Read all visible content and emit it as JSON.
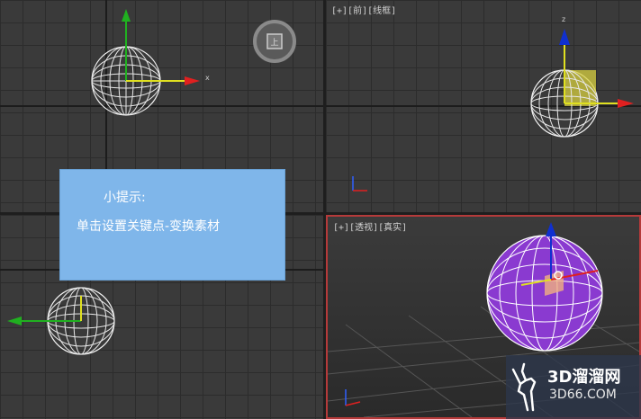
{
  "viewports": {
    "top_right": {
      "label": "[+][前][线框]"
    },
    "bottom_right": {
      "label": "[+][透视][真实]"
    }
  },
  "tip": {
    "title": "小提示:",
    "body": "单击设置关键点-变换素材"
  },
  "watermark": {
    "main": "3D溜溜网",
    "sub": "3D66.COM"
  },
  "colors": {
    "viewport_bg": "#3a3a3a",
    "active_border": "#b53a3a",
    "tip_bg": "#7fb6ea",
    "sphere_selected": "#8a3ad0",
    "axis_x": "#e02020",
    "axis_y": "#20b020",
    "axis_z": "#1030d0"
  },
  "icons": [
    "viewcube-icon",
    "deer-logo-icon",
    "axis-tripod-icon",
    "move-gizmo-icon"
  ]
}
